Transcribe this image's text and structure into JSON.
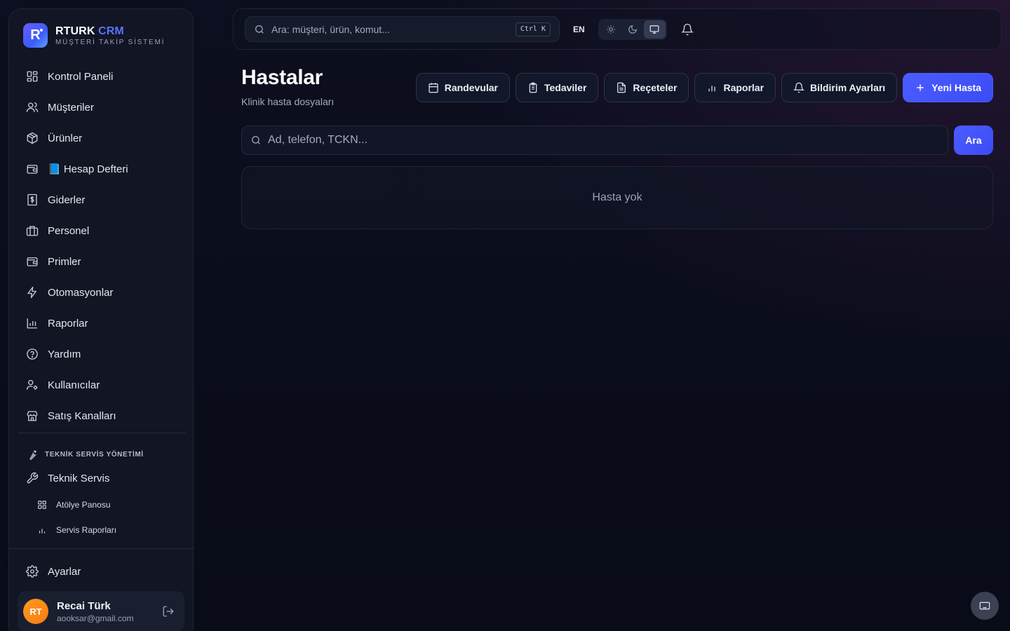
{
  "brand": {
    "name_part1": "RTURK",
    "name_part2": "CRM",
    "subtitle": "MÜŞTERİ TAKİP SİSTEMİ",
    "logo_letter": "R"
  },
  "sidebar": {
    "items": [
      {
        "label": "Kontrol Paneli",
        "icon": "grid-icon"
      },
      {
        "label": "Müşteriler",
        "icon": "users-icon"
      },
      {
        "label": "Ürünler",
        "icon": "box-icon"
      },
      {
        "label": "📘 Hesap Defteri",
        "icon": "wallet-icon"
      },
      {
        "label": "Giderler",
        "icon": "receipt-icon"
      },
      {
        "label": "Personel",
        "icon": "briefcase-icon"
      },
      {
        "label": "Primler",
        "icon": "wallet-icon"
      },
      {
        "label": "Otomasyonlar",
        "icon": "zap-icon"
      },
      {
        "label": "Raporlar",
        "icon": "bar-chart-icon"
      },
      {
        "label": "Yardım",
        "icon": "help-circle-icon"
      },
      {
        "label": "Kullanıcılar",
        "icon": "user-cog-icon"
      },
      {
        "label": "Satış Kanalları",
        "icon": "store-icon"
      }
    ],
    "section_title": "TEKNİK SERVİS YÖNETİMİ",
    "technical_service": "Teknik Servis",
    "sub_items": [
      {
        "label": "Atölye Panosu",
        "icon": "grid-icon"
      },
      {
        "label": "Servis Raporları",
        "icon": "bar-chart-icon"
      }
    ],
    "settings": "Ayarlar",
    "user": {
      "initials": "RT",
      "name": "Recai Türk",
      "email": "aooksar@gmail.com"
    }
  },
  "topbar": {
    "search_placeholder": "Ara: müşteri, ürün, komut...",
    "shortcut": "Ctrl K",
    "language": "EN",
    "theme_active": "system"
  },
  "page": {
    "title": "Hastalar",
    "subtitle": "Klinik hasta dosyaları",
    "actions": {
      "appointments": "Randevular",
      "treatments": "Tedaviler",
      "prescriptions": "Reçeteler",
      "reports": "Raporlar",
      "notification_settings": "Bildirim Ayarları",
      "new_patient": "Yeni Hasta"
    },
    "search_placeholder": "Ad, telefon, TCKN...",
    "search_button": "Ara",
    "empty_state": "Hasta yok"
  },
  "colors": {
    "accent": "#4c5cff",
    "background": "#0a0c1a",
    "avatar": "#f98b1a"
  }
}
